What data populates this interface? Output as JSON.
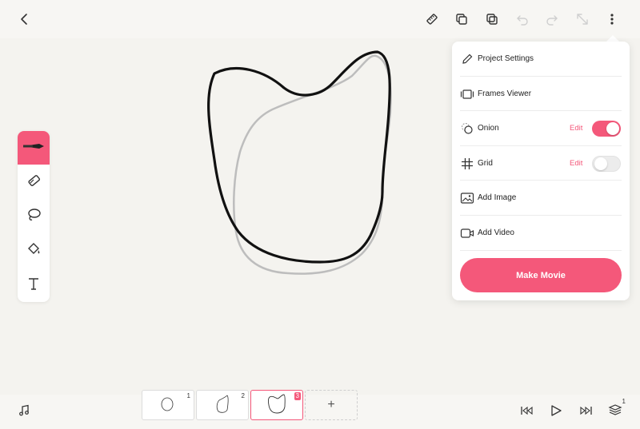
{
  "menu": {
    "items": [
      {
        "label": "Project Settings",
        "icon": "pencil-icon"
      },
      {
        "label": "Frames Viewer",
        "icon": "frames-icon"
      },
      {
        "label": "Onion",
        "icon": "onion-icon",
        "edit": "Edit",
        "toggle": true
      },
      {
        "label": "Grid",
        "icon": "grid-icon",
        "edit": "Edit",
        "toggle": false
      },
      {
        "label": "Add Image",
        "icon": "image-icon"
      },
      {
        "label": "Add Video",
        "icon": "video-icon"
      }
    ],
    "make_movie": "Make Movie"
  },
  "timeline": {
    "frames": [
      {
        "number": "1",
        "active": false
      },
      {
        "number": "2",
        "active": false
      },
      {
        "number": "3",
        "active": true
      }
    ],
    "add_label": "+",
    "layer_count": "1"
  },
  "colors": {
    "accent": "#f4587a",
    "stroke": "#111111",
    "onion_stroke": "#bdbdbd"
  },
  "icons": {
    "topbar": [
      "back-arrow-icon",
      "ruler-icon",
      "duplicate-frame-icon",
      "copy-icon",
      "undo-icon",
      "redo-icon",
      "expand-icon",
      "more-icon"
    ],
    "tools": [
      "pen-icon",
      "eraser-icon",
      "lasso-icon",
      "bucket-icon",
      "text-icon"
    ],
    "bottom": [
      "music-icon",
      "skip-start-icon",
      "play-icon",
      "skip-end-icon",
      "layers-icon"
    ]
  }
}
